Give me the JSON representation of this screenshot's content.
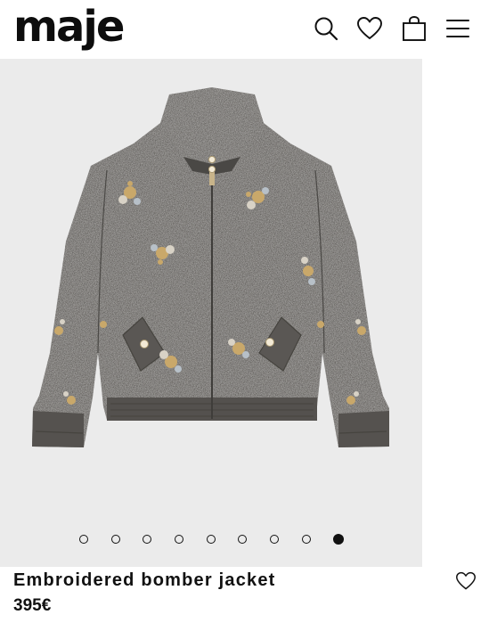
{
  "header": {
    "logo_text": "maje",
    "icons": [
      "search-icon",
      "heart-icon",
      "bag-icon",
      "menu-icon"
    ]
  },
  "gallery": {
    "image": "embroidered-bomber-jacket-photo",
    "slide_count": 9,
    "active_slide": 9
  },
  "product": {
    "name": "Embroidered bomber jacket",
    "price": "395€"
  },
  "colors": {
    "background": "#ffffff",
    "gallery_bg": "#ebebeb",
    "jacket_grey": "#5e5b58",
    "text": "#111111"
  }
}
